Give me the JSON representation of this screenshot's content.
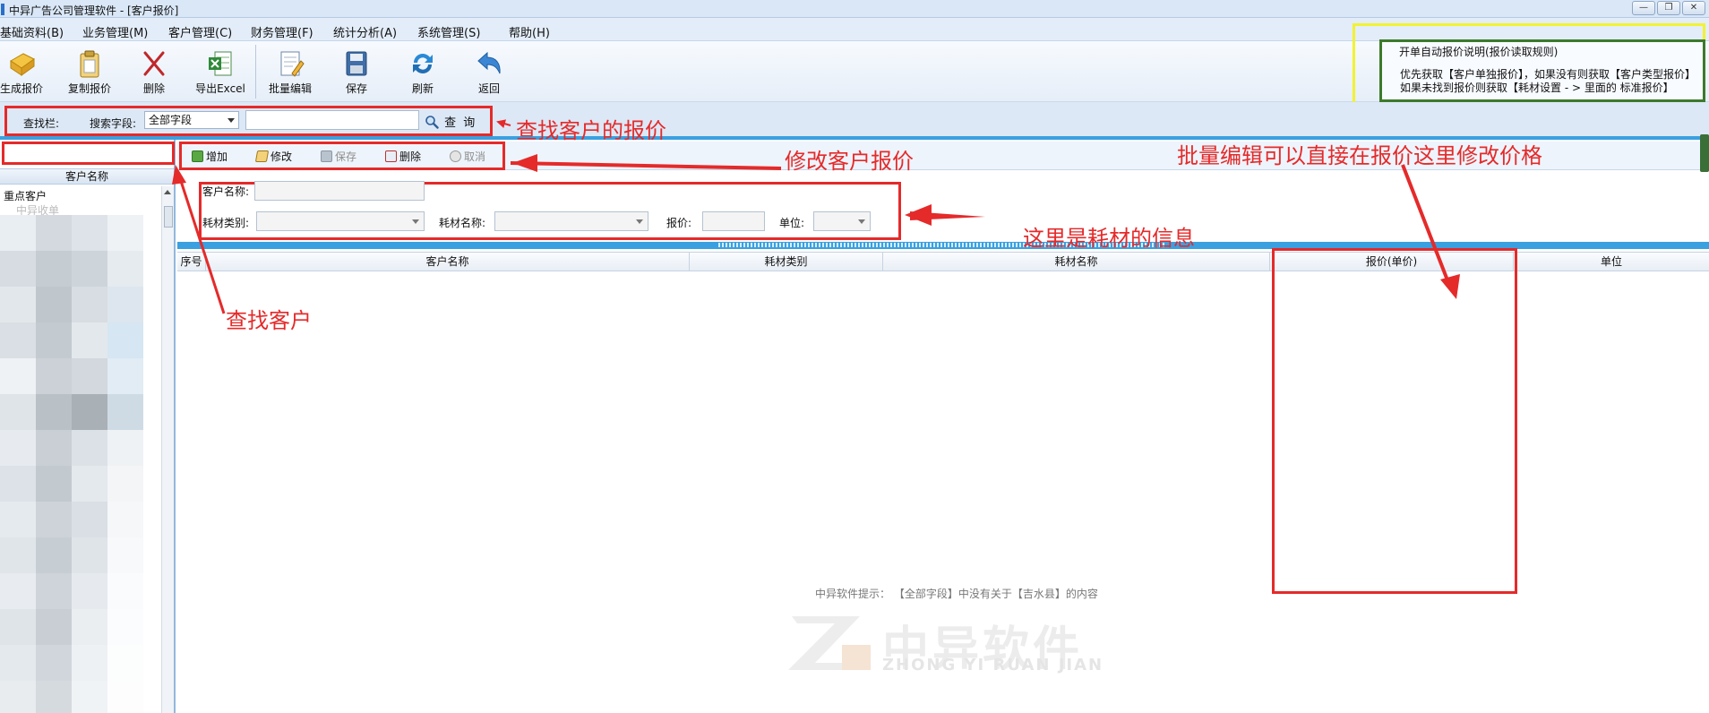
{
  "window": {
    "title": "中异广告公司管理软件 - [客户报价]"
  },
  "menu": [
    "基础资料(B)",
    "业务管理(M)",
    "客户管理(C)",
    "财务管理(F)",
    "统计分析(A)",
    "系统管理(S)",
    "帮助(H)"
  ],
  "toolbar": {
    "generate_quote": "生成报价",
    "copy_quote": "复制报价",
    "delete": "删除",
    "export_excel": "导出Excel",
    "batch_edit": "批量编辑",
    "save": "保存",
    "refresh": "刷新",
    "back": "返回"
  },
  "info_panel": {
    "title": "开单自动报价说明(报价读取规则)",
    "line1": "优先获取【客户单独报价】，如果没有则获取【客户类型报价】",
    "line2": "如果未找到报价则获取【耗材设置 - > 里面的 标准报价】"
  },
  "search": {
    "bar_label": "查找栏:",
    "field_label": "搜索字段:",
    "field_value": "全部字段",
    "query_input": "",
    "query_button": "查 询"
  },
  "left_pane": {
    "header": "客户名称",
    "tree": [
      "重点客户",
      "中异收单"
    ]
  },
  "edit_bar": {
    "add": "增加",
    "modify": "修改",
    "save": "保存",
    "delete": "删除",
    "cancel": "取消"
  },
  "form": {
    "customer_name_label": "客户名称:",
    "material_type_label": "耗材类别:",
    "material_name_label": "耗材名称:",
    "price_label": "报价:",
    "unit_label": "单位:"
  },
  "grid": {
    "columns": [
      "序号",
      "客户名称",
      "耗材类别",
      "耗材名称",
      "报价(单价)",
      "单位"
    ],
    "hint": "中异软件提示： 【全部字段】中没有关于【吉水县】的内容"
  },
  "watermark": {
    "text": "中异软件",
    "sub": "ZHONG YI RUAN JIAN"
  },
  "annotations": {
    "search_quote": "查找客户的报价",
    "modify_quote": "修改客户报价",
    "material_info": "这里是耗材的信息",
    "find_customer": "查找客户",
    "batch_edit": "批量编辑可以直接在报价这里修改价格"
  },
  "colors": {
    "annotation_red": "#e52a2a",
    "highlight_yellow": "#f2f232",
    "accent_blue": "#3aa0e0"
  }
}
